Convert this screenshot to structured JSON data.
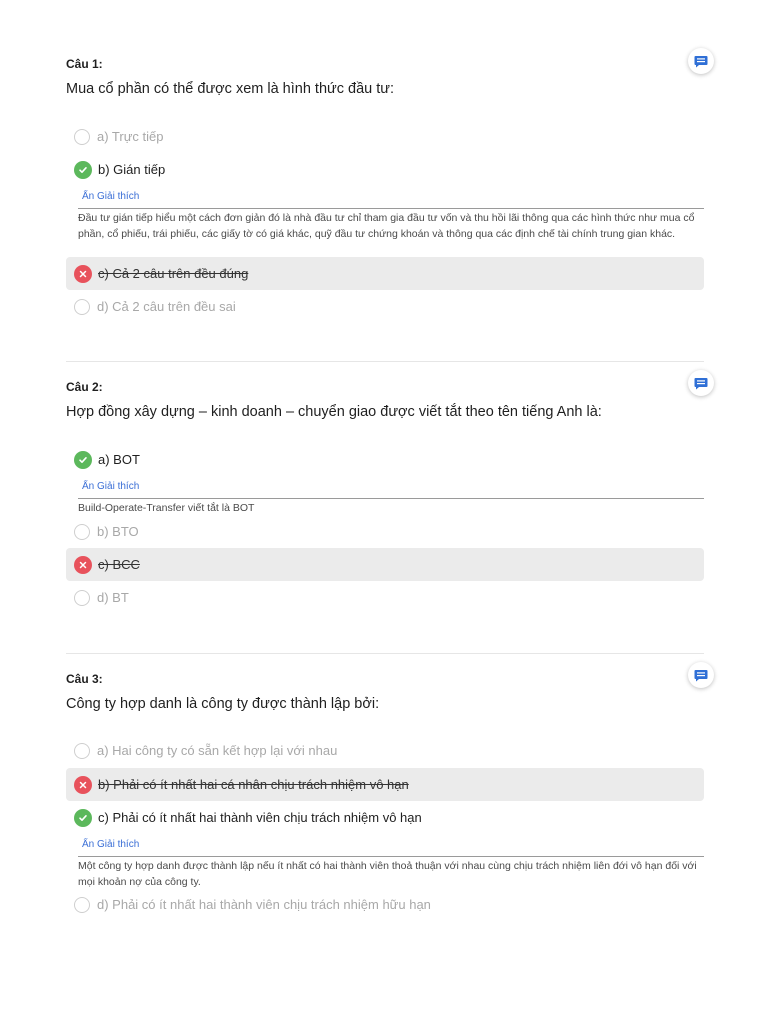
{
  "questions": [
    {
      "label": "Câu 1:",
      "text": "Mua cổ phần có thể được xem là hình thức đầu tư:",
      "options": [
        {
          "text": "a) Trực tiếp",
          "state": "neutral"
        },
        {
          "text": "b) Gián tiếp",
          "state": "correct"
        },
        {
          "text": "c) Cả 2 câu trên đều đúng",
          "state": "wrong"
        },
        {
          "text": "d) Cả 2 câu trên đều sai",
          "state": "neutral"
        }
      ],
      "explanation_link": "Ẩn Giải thích",
      "explanation": "Đầu tư gián tiếp hiểu một cách đơn giản đó là nhà đầu tư chỉ tham gia đầu tư vốn và thu hồi lãi thông qua các hình thức như mua cổ phần, cổ phiếu, trái phiếu, các giấy tờ có giá khác, quỹ đầu tư chứng khoán và thông qua các định chế tài chính trung gian khác."
    },
    {
      "label": "Câu 2:",
      "text": "Hợp đồng xây dựng – kinh doanh – chuyển giao được viết tắt theo tên tiếng Anh là:",
      "options": [
        {
          "text": "a) BOT",
          "state": "correct"
        },
        {
          "text": "b) BTO",
          "state": "neutral"
        },
        {
          "text": "c) BCC",
          "state": "wrong"
        },
        {
          "text": "d) BT",
          "state": "neutral"
        }
      ],
      "explanation_link": "Ẩn Giải thích",
      "explanation": "Build-Operate-Transfer viết tắt là BOT"
    },
    {
      "label": "Câu 3:",
      "text": "Công ty hợp danh là công ty được thành lập bởi:",
      "options": [
        {
          "text": "a) Hai công ty có sẵn kết hợp lại với nhau",
          "state": "neutral"
        },
        {
          "text": "b) Phải có ít nhất hai cá nhân chịu trách nhiệm vô hạn",
          "state": "wrong"
        },
        {
          "text": "c) Phải có ít nhất hai thành viên chịu trách nhiệm vô hạn",
          "state": "correct"
        },
        {
          "text": "d) Phải có ít nhất hai thành viên chịu trách nhiệm hữu hạn",
          "state": "neutral"
        }
      ],
      "explanation_link": "Ẩn Giải thích",
      "explanation": "Một công ty hợp danh được thành lập nếu ít nhất có hai thành viên thoả thuận với nhau cùng chịu trách nhiệm liên đới vô hạn đối với mọi khoản nợ của công ty."
    }
  ],
  "icons": {
    "comment": "comment-icon",
    "check": "check-icon",
    "cross": "cross-icon"
  },
  "colors": {
    "correct": "#5cb85c",
    "wrong": "#e8525c",
    "link": "#3b6fd6",
    "comment": "#2f6fd6"
  }
}
